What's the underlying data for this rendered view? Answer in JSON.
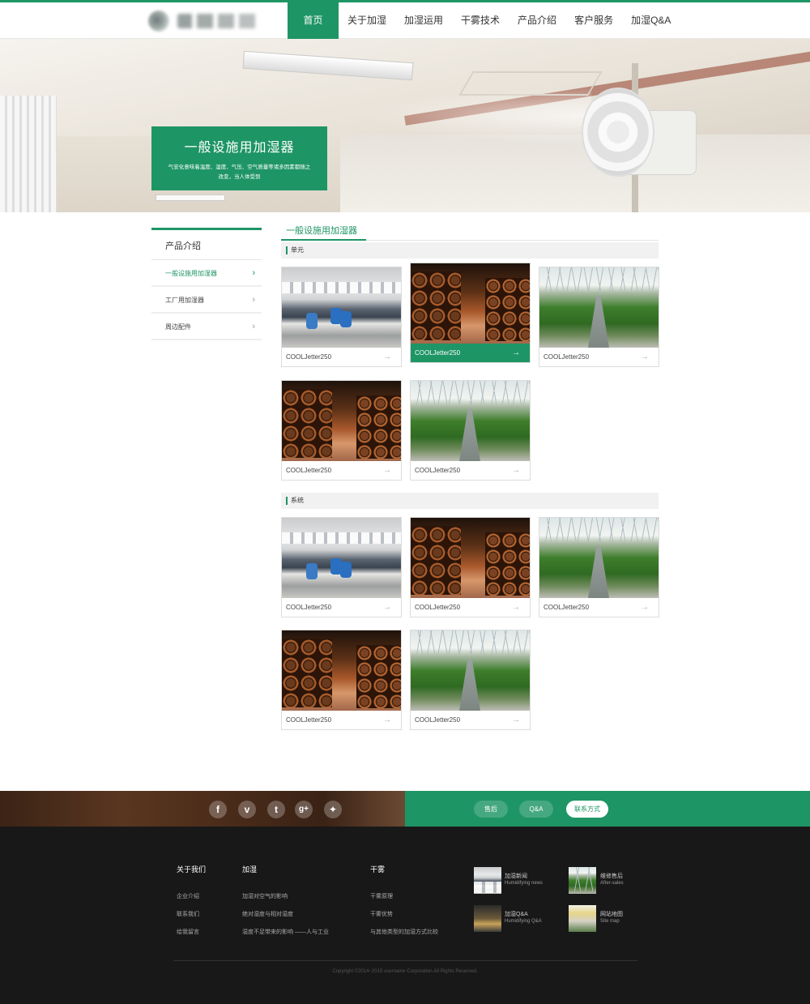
{
  "nav": {
    "items": [
      "首页",
      "关于加湿",
      "加湿运用",
      "干雾技术",
      "产品介绍",
      "客户服务",
      "加湿Q&A"
    ],
    "active": "首页"
  },
  "banner": {
    "title": "一般设施用加湿器",
    "desc": "气安化意味着温度、湿度、气压、空气质量等诸多因素都随之改变，当人体受到"
  },
  "sidebar": {
    "heading": "产品介绍",
    "items": [
      {
        "label": "一般设施用加湿器",
        "active": true
      },
      {
        "label": "工厂用加湿器",
        "active": false
      },
      {
        "label": "周边配件",
        "active": false
      }
    ]
  },
  "main": {
    "title": "一般设施用加湿器",
    "sections": [
      {
        "label": "单元",
        "cards": [
          {
            "caption": "COOLJetter250",
            "image": "factory-photo"
          },
          {
            "caption": "COOLJetter250",
            "image": "wine-cellar-photo",
            "highlighted": true
          },
          {
            "caption": "COOLJetter250",
            "image": "greenhouse-photo"
          },
          {
            "caption": "COOLJetter250",
            "image": "wine-cellar-photo"
          },
          {
            "caption": "COOLJetter250",
            "image": "greenhouse-photo"
          }
        ]
      },
      {
        "label": "系统",
        "cards": [
          {
            "caption": "COOLJetter250",
            "image": "factory-photo"
          },
          {
            "caption": "COOLJetter250",
            "image": "wine-cellar-photo"
          },
          {
            "caption": "COOLJetter250",
            "image": "greenhouse-photo"
          },
          {
            "caption": "COOLJetter250",
            "image": "wine-cellar-photo"
          },
          {
            "caption": "COOLJetter250",
            "image": "greenhouse-photo"
          }
        ]
      }
    ]
  },
  "strip": {
    "social": [
      {
        "icon": "facebook-icon",
        "glyph": "f"
      },
      {
        "icon": "vimeo-icon",
        "glyph": "v"
      },
      {
        "icon": "tumblr-icon",
        "glyph": "t"
      },
      {
        "icon": "google-plus-icon",
        "glyph": "g+"
      },
      {
        "icon": "twitter-icon",
        "glyph": "✦"
      }
    ],
    "pills": [
      "售后",
      "Q&A",
      "联系方式"
    ],
    "active_pill": "联系方式"
  },
  "footer": {
    "columns": [
      {
        "heading": "关于我们",
        "links": [
          "企业介绍",
          "联系我们",
          "给我留言"
        ]
      },
      {
        "heading": "加湿",
        "links": [
          "加湿对空气的影响",
          "绝对湿度与相对湿度",
          "湿度不足带来的影响 ——人与工业"
        ]
      },
      {
        "heading": "干雾",
        "links": [
          "干雾原理",
          "干雾优势",
          "与其他类型的加湿方式比较"
        ]
      }
    ],
    "quick": [
      {
        "zh": "加湿新闻",
        "en": "Humidifying news",
        "image": "factory-photo"
      },
      {
        "zh": "维修售后",
        "en": "After-sales",
        "image": "greenhouse-photo"
      },
      {
        "zh": "加湿Q&A",
        "en": "Humidifying Q&A",
        "image": "people-photo"
      },
      {
        "zh": "网站地图",
        "en": "Site map",
        "image": "storefront-photo"
      }
    ],
    "copyright": "Copyright ©2014~2015 username Corporation.All Rights Reserved."
  },
  "colors": {
    "accent": "#1e9565",
    "footer_bg": "#181818"
  }
}
